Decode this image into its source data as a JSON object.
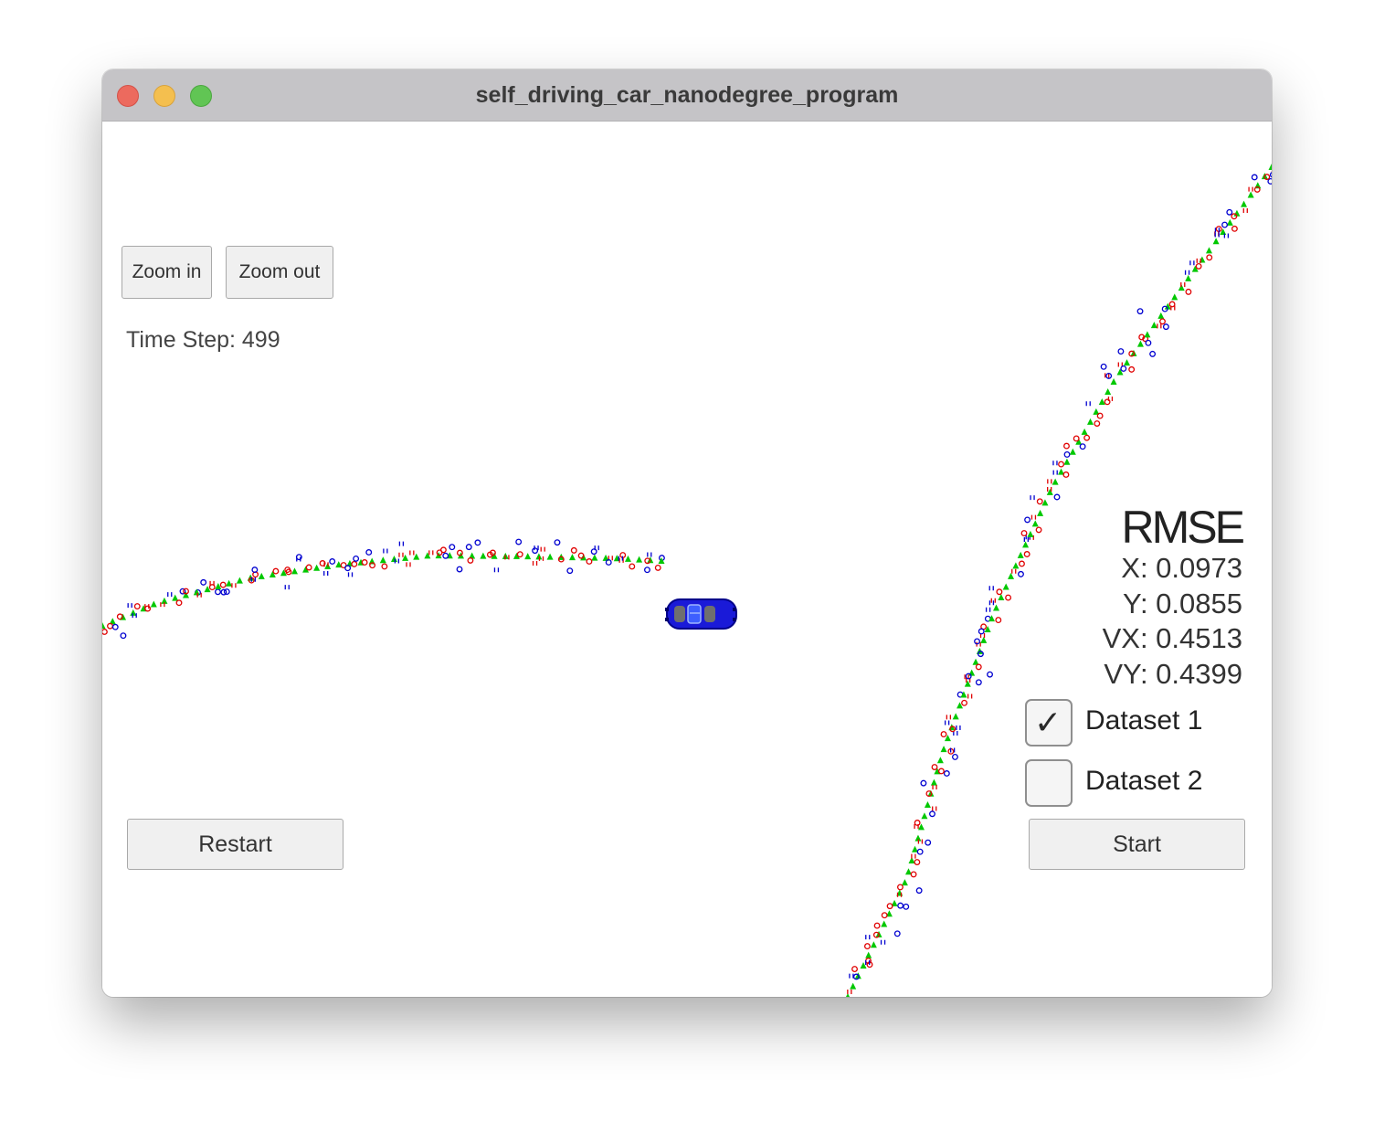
{
  "window": {
    "title": "self_driving_car_nanodegree_program",
    "traffic_lights": [
      "close-button",
      "minimize-button",
      "maximize-button"
    ]
  },
  "controls": {
    "zoom_in": "Zoom in",
    "zoom_out": "Zoom out",
    "restart": "Restart",
    "start": "Start"
  },
  "time_step": {
    "label": "Time Step: 499"
  },
  "rmse": {
    "title": "RMSE",
    "x": "X: 0.0973",
    "y": "Y: 0.0855",
    "vx": "VX: 0.4513",
    "vy": "VY: 0.4399"
  },
  "datasets": [
    {
      "label": "Dataset 1",
      "checked": true
    },
    {
      "label": "Dataset 2",
      "checked": false
    }
  ],
  "legend_colors": {
    "ground_truth": "#00c800",
    "lidar": "#e00000",
    "radar": "#0000d0",
    "car": "#1a1ad8"
  }
}
